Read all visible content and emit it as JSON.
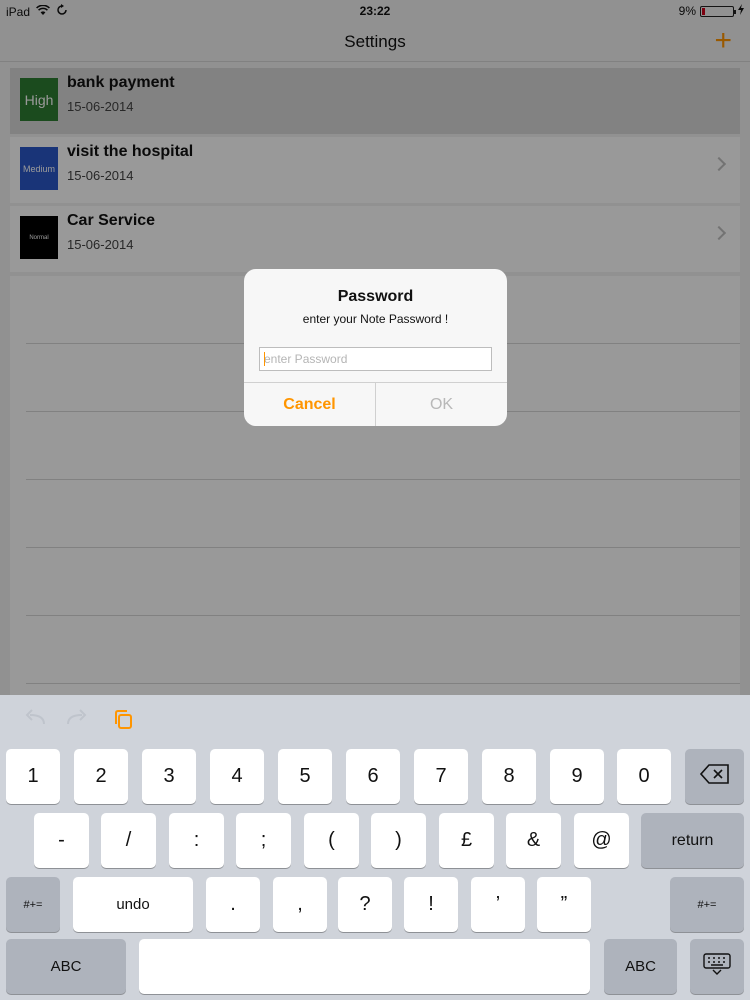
{
  "status": {
    "device": "iPad",
    "time": "23:22",
    "battery_percent": "9%",
    "battery_level": 0.09
  },
  "nav": {
    "title": "Settings",
    "add_icon": "plus-icon"
  },
  "notes": [
    {
      "title": "bank payment",
      "date": "15-06-2014",
      "priority": "High",
      "color": "#2e7d32",
      "selected": true
    },
    {
      "title": "visit the hospital",
      "date": "15-06-2014",
      "priority": "Medium",
      "color": "#2a57c9",
      "selected": false
    },
    {
      "title": "Car Service",
      "date": "15-06-2014",
      "priority": "Normal",
      "color": "#000000",
      "selected": false
    }
  ],
  "alert": {
    "title": "Password",
    "message": "enter your Note Password !",
    "input_value": "",
    "input_placeholder": "enter Password",
    "cancel_label": "Cancel",
    "ok_label": "OK"
  },
  "keyboard": {
    "shortcuts": {
      "undo_icon": "undo-icon",
      "redo_icon": "redo-icon",
      "paste_icon": "paste-icon"
    },
    "row1": [
      "1",
      "2",
      "3",
      "4",
      "5",
      "6",
      "7",
      "8",
      "9",
      "0"
    ],
    "delete_icon": "backspace-icon",
    "row2": [
      "-",
      "/",
      ":",
      ";",
      "(",
      ")",
      "£",
      "&",
      "@"
    ],
    "return_label": "return",
    "symbols_label": "#+=",
    "undo_label": "undo",
    "row3": [
      ".",
      ",",
      "?",
      "!",
      "’",
      "”"
    ],
    "abc_label": "ABC",
    "hide_icon": "keyboard-hide-icon"
  },
  "colors": {
    "accent": "#ff9500"
  }
}
